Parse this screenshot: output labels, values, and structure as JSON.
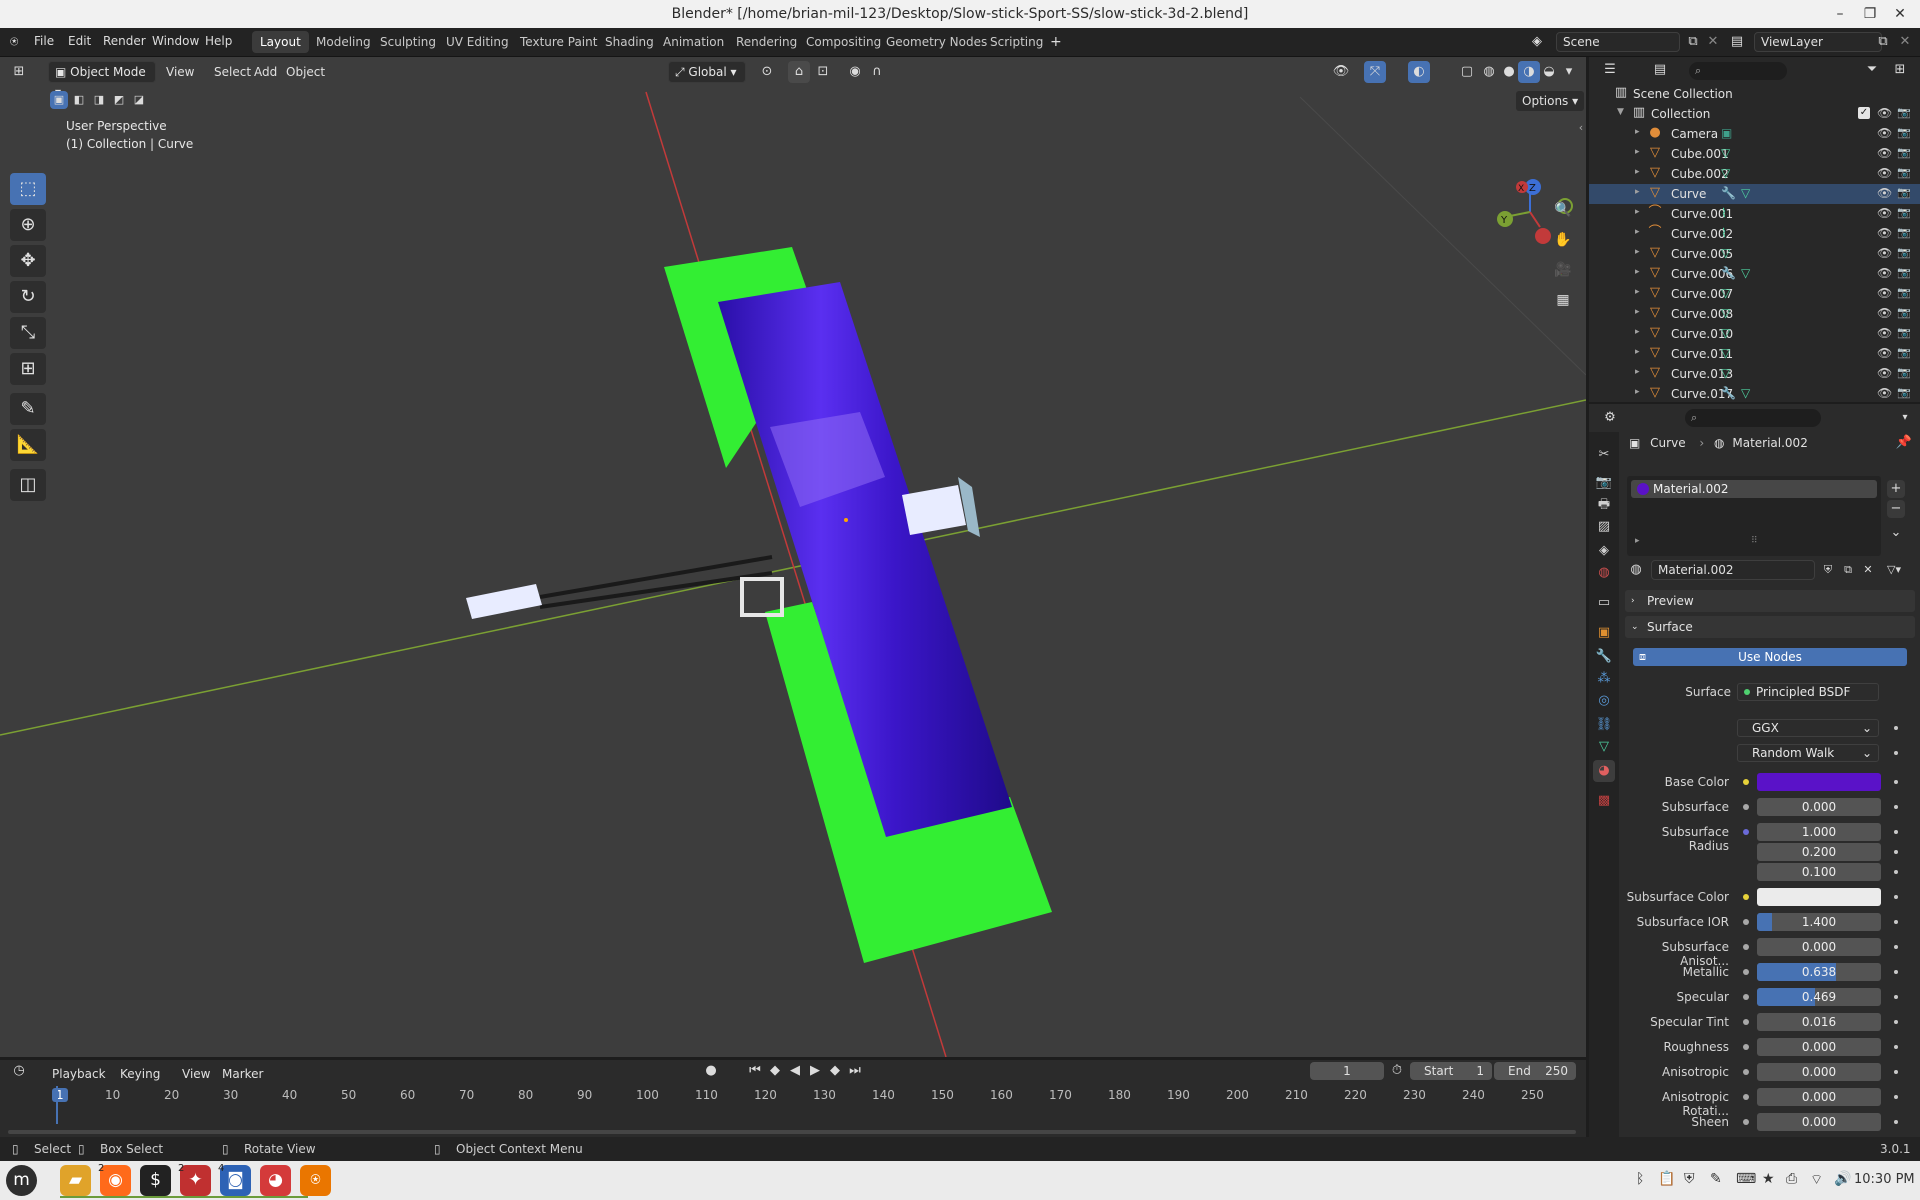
{
  "window": {
    "title": "Blender* [/home/brian-mil-123/Desktop/Slow-stick-Sport-SS/slow-stick-3d-2.blend]",
    "minimize": "–",
    "maximize": "❐",
    "close": "✕"
  },
  "menu": [
    "File",
    "Edit",
    "Render",
    "Window",
    "Help"
  ],
  "workspaces": [
    "Layout",
    "Modeling",
    "Sculpting",
    "UV Editing",
    "Texture Paint",
    "Shading",
    "Animation",
    "Rendering",
    "Compositing",
    "Geometry Nodes",
    "Scripting"
  ],
  "active_workspace": "Layout",
  "scene_name": "Scene",
  "view_layer": "ViewLayer",
  "viewport": {
    "mode": "Object Mode",
    "menus": [
      "View",
      "Select",
      "Add",
      "Object"
    ],
    "transform_orientation": "Global",
    "options_label": "Options",
    "info_line1": "User Perspective",
    "info_line2": "(1) Collection | Curve",
    "gizmo_x": "X",
    "gizmo_y": "Y",
    "gizmo_z": "Z"
  },
  "outliner": {
    "scene_collection": "Scene Collection",
    "collection": "Collection",
    "items": [
      {
        "name": "Camera",
        "type": "camera"
      },
      {
        "name": "Cube.001",
        "type": "mesh"
      },
      {
        "name": "Cube.002",
        "type": "mesh"
      },
      {
        "name": "Curve",
        "type": "mesh",
        "modifier": true
      },
      {
        "name": "Curve.001",
        "type": "curve"
      },
      {
        "name": "Curve.002",
        "type": "curve"
      },
      {
        "name": "Curve.005",
        "type": "mesh"
      },
      {
        "name": "Curve.006",
        "type": "mesh",
        "modifier": true
      },
      {
        "name": "Curve.007",
        "type": "mesh"
      },
      {
        "name": "Curve.008",
        "type": "mesh"
      },
      {
        "name": "Curve.010",
        "type": "mesh"
      },
      {
        "name": "Curve.011",
        "type": "mesh"
      },
      {
        "name": "Curve.013",
        "type": "mesh"
      },
      {
        "name": "Curve.017",
        "type": "mesh",
        "modifier": true
      }
    ]
  },
  "properties": {
    "breadcrumb_object": "Curve",
    "breadcrumb_material": "Material.002",
    "slot_name": "Material.002",
    "material_name": "Material.002",
    "preview_label": "Preview",
    "surface_panel_label": "Surface",
    "use_nodes_label": "Use Nodes",
    "surface_label": "Surface",
    "surface_shader": "Principled BSDF",
    "distribution": "GGX",
    "subsurface_method": "Random Walk",
    "fields": [
      {
        "label": "Base Color",
        "kind": "color",
        "color": "#5a12c8"
      },
      {
        "label": "Subsurface",
        "value": "0.000",
        "fill": 0
      },
      {
        "label": "Subsurface Radius",
        "value": "1.000",
        "fill": 0
      },
      {
        "label": "",
        "value": "0.200",
        "fill": 0
      },
      {
        "label": "",
        "value": "0.100",
        "fill": 0
      },
      {
        "label": "Subsurface Color",
        "kind": "color",
        "color": "#ebebeb"
      },
      {
        "label": "Subsurface IOR",
        "value": "1.400",
        "fill": 0.12
      },
      {
        "label": "Subsurface Anisot...",
        "value": "0.000",
        "fill": 0
      },
      {
        "label": "Metallic",
        "value": "0.638",
        "fill": 0.638
      },
      {
        "label": "Specular",
        "value": "0.469",
        "fill": 0.469
      },
      {
        "label": "Specular Tint",
        "value": "0.016",
        "fill": 0
      },
      {
        "label": "Roughness",
        "value": "0.000",
        "fill": 0
      },
      {
        "label": "Anisotropic",
        "value": "0.000",
        "fill": 0
      },
      {
        "label": "Anisotropic Rotati...",
        "value": "0.000",
        "fill": 0
      },
      {
        "label": "Sheen",
        "value": "0.000",
        "fill": 0
      }
    ]
  },
  "timeline": {
    "menus": [
      "Playback",
      "Keying",
      "View",
      "Marker"
    ],
    "current_frame": "1",
    "start_label": "Start",
    "start_value": "1",
    "end_label": "End",
    "end_value": "250",
    "ticks": [
      "1",
      "10",
      "20",
      "30",
      "40",
      "50",
      "60",
      "70",
      "80",
      "90",
      "100",
      "110",
      "120",
      "130",
      "140",
      "150",
      "160",
      "170",
      "180",
      "190",
      "200",
      "210",
      "220",
      "230",
      "240",
      "250"
    ]
  },
  "status": {
    "select": "Select",
    "box_select": "Box Select",
    "rotate_view": "Rotate View",
    "context_menu": "Object Context Menu",
    "version": "3.0.1"
  },
  "taskbar": {
    "time": "10:30 PM",
    "badge_2": "2",
    "badge_2b": "2",
    "badge_4": "4"
  },
  "colors": {
    "accent": "#4772b3",
    "wing_green": "#33ee33",
    "fuselage_purple": "#4a1dd0",
    "x_axis": "#c23a3a",
    "y_axis": "#7ba033"
  }
}
